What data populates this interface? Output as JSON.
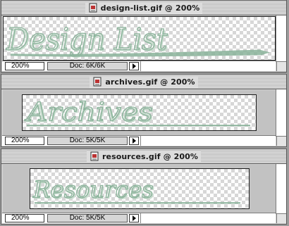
{
  "windows": [
    {
      "title": "design-list.gif @ 200%",
      "script": "Design List",
      "zoom": "200%",
      "doc_size": "Doc: 6K/6K"
    },
    {
      "title": "archives.gif @ 200%",
      "script": "Archives",
      "zoom": "200%",
      "doc_size": "Doc: 5K/5K"
    },
    {
      "title": "resources.gif @ 200%",
      "script": "Resources",
      "zoom": "200%",
      "doc_size": "Doc: 5K/5K"
    }
  ],
  "colors": {
    "script_green": "#8ab39a",
    "script_shadow": "#c9dccf",
    "transparency_checker": "#d7d7d7"
  },
  "icons": {
    "document": "gif-document-icon",
    "popup": "triangle-right-icon"
  }
}
